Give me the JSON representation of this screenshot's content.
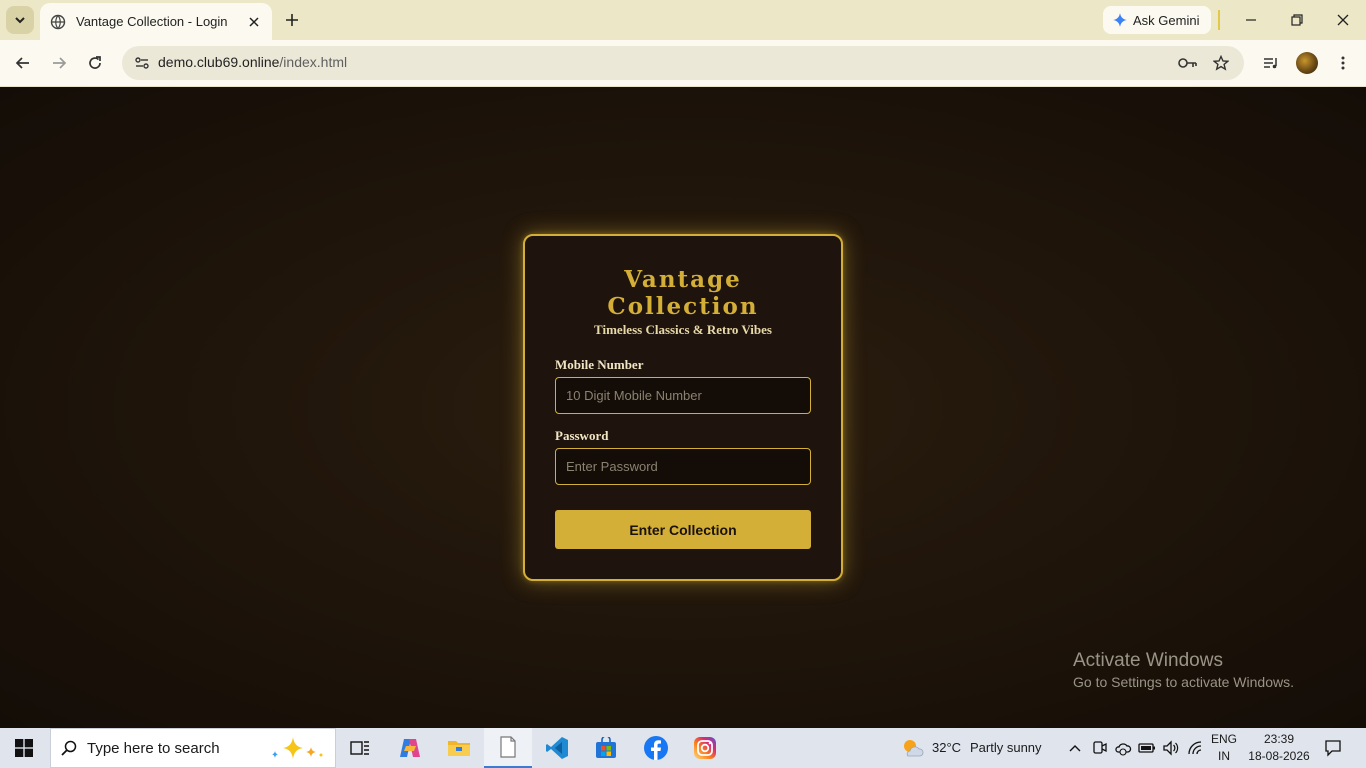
{
  "browser": {
    "tab_title": "Vantage Collection - Login",
    "url_host": "demo.club69.online",
    "url_path": "/index.html",
    "gemini_label": "Ask Gemini"
  },
  "login": {
    "title": "Vantage Collection",
    "subtitle": "Timeless Classics & Retro Vibes",
    "mobile_label": "Mobile Number",
    "mobile_placeholder": "10 Digit Mobile Number",
    "password_label": "Password",
    "password_placeholder": "Enter Password",
    "submit_label": "Enter Collection"
  },
  "watermark": {
    "line1": "Activate Windows",
    "line2": "Go to Settings to activate Windows."
  },
  "taskbar": {
    "search_placeholder": "Type here to search",
    "weather_temp": "32°C",
    "weather_text": "Partly sunny",
    "lang_line1": "ENG",
    "lang_line2": "IN",
    "time": "23:39",
    "date": "18-08-2026",
    "apps": [
      "task-view",
      "copilot",
      "file-explorer",
      "notepad",
      "vscode",
      "microsoft-store",
      "facebook",
      "instagram"
    ]
  },
  "colors": {
    "accent_gold": "#d4af37",
    "card_bg": "#1e130d",
    "page_bg": "#1a120b",
    "tab_strip": "#ece7c6"
  }
}
